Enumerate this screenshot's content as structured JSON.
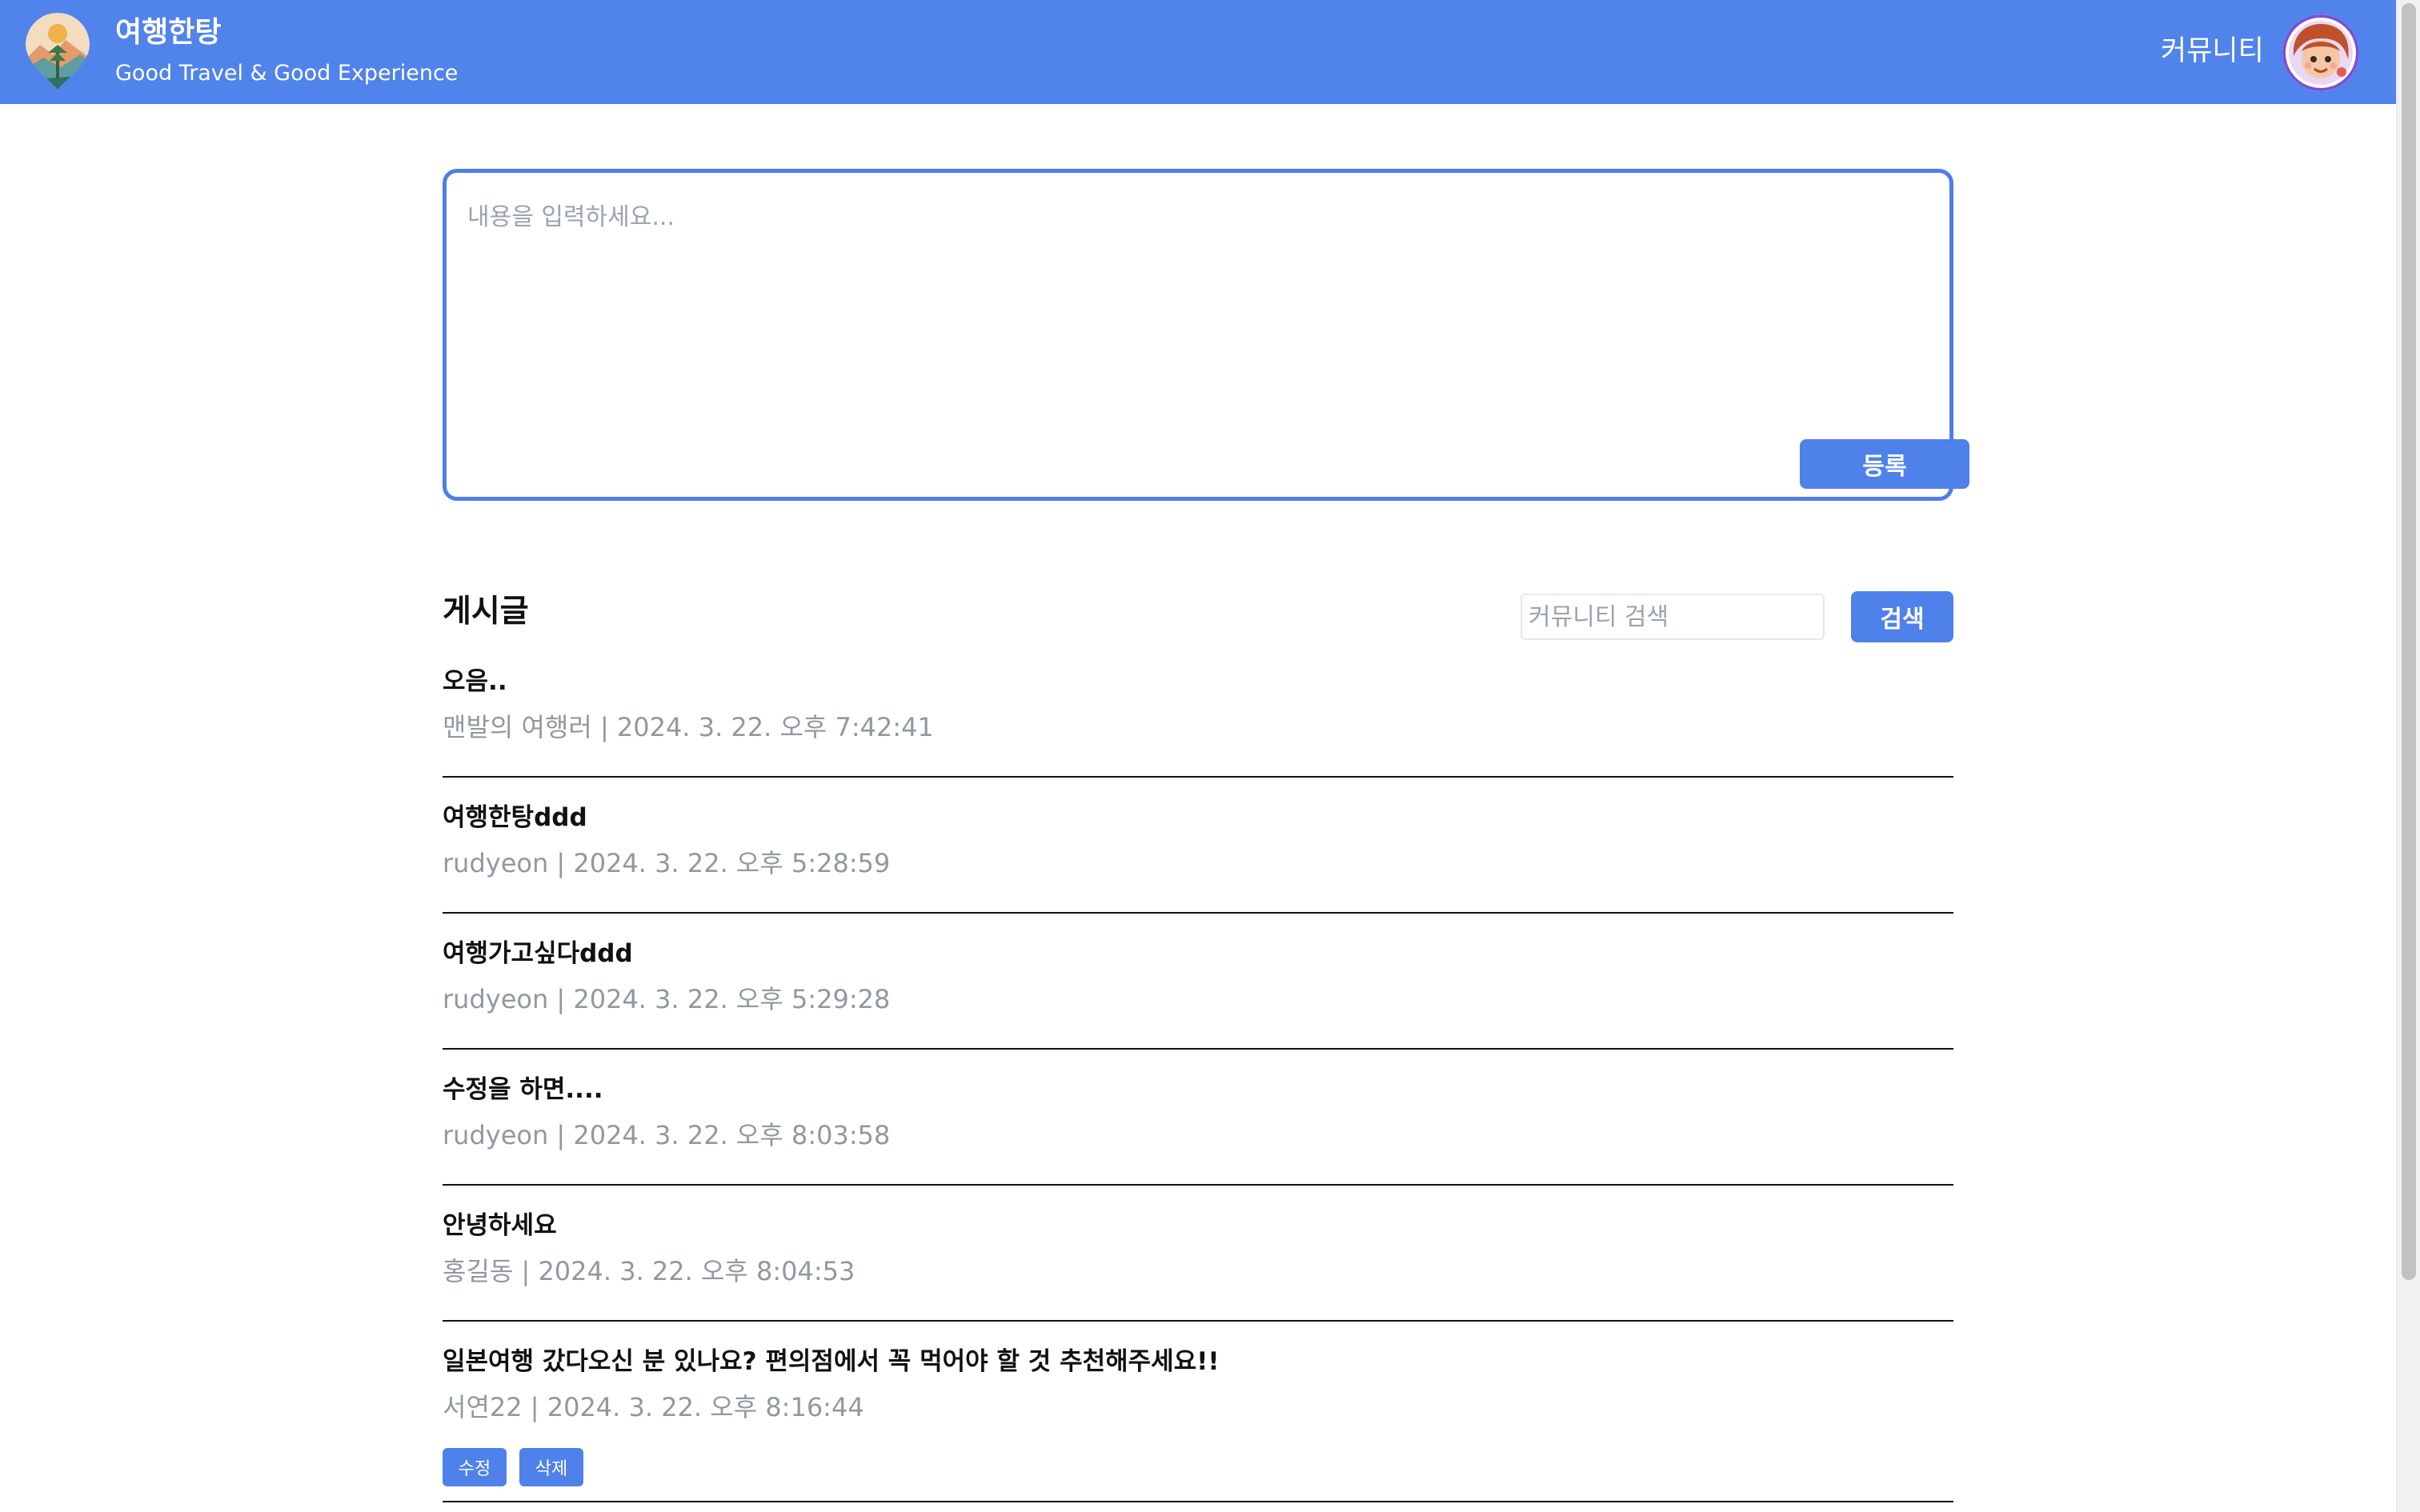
{
  "header": {
    "brand_title": "여행한탕",
    "brand_subtitle": "Good Travel & Good Experience",
    "nav_community": "커뮤니티"
  },
  "compose": {
    "placeholder": "내용을 입력하세요...",
    "value": "",
    "submit_label": "등록"
  },
  "posts_section": {
    "title": "게시글",
    "search_placeholder": "커뮤니티 검색",
    "search_value": "",
    "search_button": "검색"
  },
  "posts": [
    {
      "title": "오음..",
      "author": "맨발의 여행러",
      "date": "2024. 3. 22. 오후 7:42:41",
      "meta": "맨발의 여행러 | 2024. 3. 22. 오후 7:42:41"
    },
    {
      "title": "여행한탕ddd",
      "author": "rudyeon",
      "date": "2024. 3. 22. 오후 5:28:59",
      "meta": "rudyeon | 2024. 3. 22. 오후 5:28:59"
    },
    {
      "title": "여행가고싶다ddd",
      "author": "rudyeon",
      "date": "2024. 3. 22. 오후 5:29:28",
      "meta": "rudyeon | 2024. 3. 22. 오후 5:29:28"
    },
    {
      "title": "수정을 하면....",
      "author": "rudyeon",
      "date": "2024. 3. 22. 오후 8:03:58",
      "meta": "rudyeon | 2024. 3. 22. 오후 8:03:58"
    },
    {
      "title": "안녕하세요",
      "author": "홍길동",
      "date": "2024. 3. 22. 오후 8:04:53",
      "meta": "홍길동 | 2024. 3. 22. 오후 8:04:53"
    },
    {
      "title": "일본여행 갔다오신 분 있나요? 편의점에서 꼭 먹어야 할 것 추천해주세요!!",
      "author": "서연22",
      "date": "2024. 3. 22. 오후 8:16:44",
      "meta": "서연22 | 2024. 3. 22. 오후 8:16:44",
      "edit_label": "수정",
      "delete_label": "삭제"
    }
  ],
  "colors": {
    "header_bg": "#5083eb",
    "accent": "#4f81ea",
    "meta_text": "#9198a1"
  },
  "icons": {
    "logo": "travel-logo-icon",
    "avatar": "user-avatar"
  }
}
